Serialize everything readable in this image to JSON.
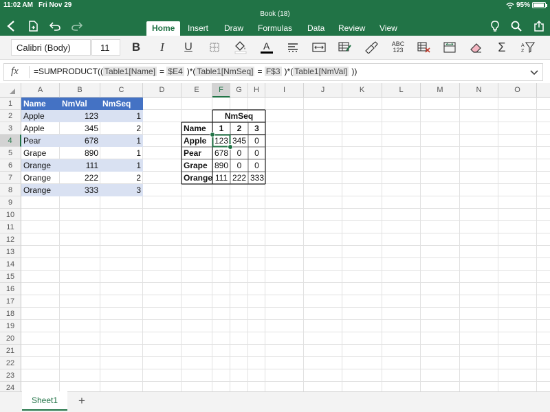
{
  "status": {
    "time": "11:02 AM",
    "date": "Fri Nov 29",
    "battery": "95%",
    "battery_level": 0.95
  },
  "doc": {
    "title": "Book (18)"
  },
  "tabs": [
    {
      "label": "Home",
      "active": true
    },
    {
      "label": "Insert",
      "active": false
    },
    {
      "label": "Draw",
      "active": false
    },
    {
      "label": "Formulas",
      "active": false
    },
    {
      "label": "Data",
      "active": false
    },
    {
      "label": "Review",
      "active": false
    },
    {
      "label": "View",
      "active": false
    }
  ],
  "ribbon": {
    "font_name": "Calibri (Body)",
    "font_size": "11",
    "number_format_label": "ABC\n123"
  },
  "formula_bar": {
    "fx": "fx",
    "parts": {
      "p0": "=SUMPRODUCT((",
      "r1": "Table1[Name]",
      "p1": "=",
      "r2": "$E4",
      "p2": ")*(",
      "r3": "Table1[NmSeq]",
      "p3": "=",
      "r4": "F$3",
      "p4": ")*(",
      "r5": "Table1[NmVal]",
      "p5": "))"
    }
  },
  "columns": [
    "A",
    "B",
    "C",
    "D",
    "E",
    "F",
    "G",
    "H",
    "I",
    "J",
    "K",
    "L",
    "M",
    "N",
    "O"
  ],
  "selected_column": "F",
  "rows": [
    "1",
    "2",
    "3",
    "4",
    "5",
    "6",
    "7",
    "8",
    "9",
    "10",
    "11",
    "12",
    "13",
    "14",
    "15",
    "16",
    "17",
    "18",
    "19",
    "20",
    "21",
    "22",
    "23",
    "24"
  ],
  "selected_row": "4",
  "table1": {
    "headers": [
      "Name",
      "NmVal",
      "NmSeq"
    ],
    "rows": [
      [
        "Apple",
        "123",
        "1"
      ],
      [
        "Apple",
        "345",
        "2"
      ],
      [
        "Pear",
        "678",
        "1"
      ],
      [
        "Grape",
        "890",
        "1"
      ],
      [
        "Orange",
        "111",
        "1"
      ],
      [
        "Orange",
        "222",
        "2"
      ],
      [
        "Orange",
        "333",
        "3"
      ]
    ]
  },
  "pivot": {
    "title": "NmSeq",
    "row_header": "Name",
    "seq": [
      "1",
      "2",
      "3"
    ],
    "rows": [
      {
        "name": "Apple",
        "values": [
          "123",
          "345",
          "0"
        ]
      },
      {
        "name": "Pear",
        "values": [
          "678",
          "0",
          "0"
        ]
      },
      {
        "name": "Grape",
        "values": [
          "890",
          "0",
          "0"
        ]
      },
      {
        "name": "Orange",
        "values": [
          "111",
          "222",
          "333"
        ]
      }
    ]
  },
  "sheets": [
    {
      "label": "Sheet1",
      "active": true
    }
  ],
  "colors": {
    "brand": "#217346",
    "table_header": "#4472c4",
    "table_band": "#d9e1f2"
  }
}
